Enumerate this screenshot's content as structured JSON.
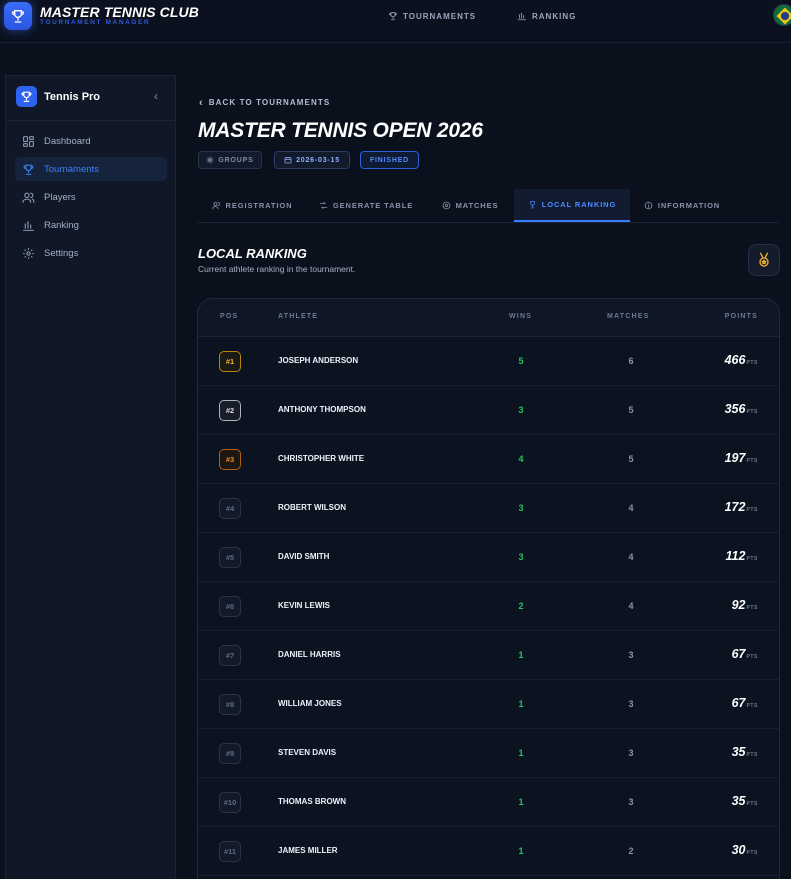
{
  "app": {
    "title": "MASTER TENNIS CLUB",
    "subtitle": "TOURNAMENT MANAGER"
  },
  "top_nav": [
    {
      "label": "TOURNAMENTS",
      "icon": "trophy-icon"
    },
    {
      "label": "RANKING",
      "icon": "bar-chart-icon"
    }
  ],
  "sidebar": {
    "title": "Tennis Pro",
    "items": [
      {
        "label": "Dashboard",
        "icon": "dashboard-icon",
        "active": false
      },
      {
        "label": "Tournaments",
        "icon": "trophy-icon",
        "active": true
      },
      {
        "label": "Players",
        "icon": "users-icon",
        "active": false
      },
      {
        "label": "Ranking",
        "icon": "bar-chart-icon",
        "active": false
      },
      {
        "label": "Settings",
        "icon": "gear-icon",
        "active": false
      }
    ]
  },
  "main": {
    "back_label": "BACK TO TOURNAMENTS",
    "title": "MASTER TENNIS OPEN 2026",
    "chips": {
      "format": "GROUPS",
      "date": "2026-03-15",
      "status": "FINISHED"
    },
    "tabs": [
      {
        "label": "REGISTRATION",
        "icon": "users-icon",
        "active": false
      },
      {
        "label": "GENERATE TABLE",
        "icon": "shuffle-icon",
        "active": false
      },
      {
        "label": "MATCHES",
        "icon": "target-icon",
        "active": false
      },
      {
        "label": "LOCAL RANKING",
        "icon": "trophy-icon",
        "active": true
      },
      {
        "label": "INFORMATION",
        "icon": "info-icon",
        "active": false
      }
    ],
    "section": {
      "title": "LOCAL RANKING",
      "subtitle": "Current athlete ranking in the tournament."
    }
  },
  "ranking": {
    "columns": {
      "pos": "POS",
      "athlete": "ATHLETE",
      "wins": "WINS",
      "matches": "MATCHES",
      "points": "POINTS"
    },
    "points_unit": "PTS",
    "rows": [
      {
        "pos": "#1",
        "athlete": "JOSEPH ANDERSON",
        "wins": "5",
        "matches": "6",
        "points": "466",
        "tier": "gold"
      },
      {
        "pos": "#2",
        "athlete": "ANTHONY THOMPSON",
        "wins": "3",
        "matches": "5",
        "points": "356",
        "tier": "silver"
      },
      {
        "pos": "#3",
        "athlete": "CHRISTOPHER WHITE",
        "wins": "4",
        "matches": "5",
        "points": "197",
        "tier": "bronze"
      },
      {
        "pos": "#4",
        "athlete": "ROBERT WILSON",
        "wins": "3",
        "matches": "4",
        "points": "172",
        "tier": "none"
      },
      {
        "pos": "#5",
        "athlete": "DAVID SMITH",
        "wins": "3",
        "matches": "4",
        "points": "112",
        "tier": "none"
      },
      {
        "pos": "#6",
        "athlete": "KEVIN LEWIS",
        "wins": "2",
        "matches": "4",
        "points": "92",
        "tier": "none"
      },
      {
        "pos": "#7",
        "athlete": "DANIEL HARRIS",
        "wins": "1",
        "matches": "3",
        "points": "67",
        "tier": "none"
      },
      {
        "pos": "#8",
        "athlete": "WILLIAM JONES",
        "wins": "1",
        "matches": "3",
        "points": "67",
        "tier": "none"
      },
      {
        "pos": "#9",
        "athlete": "STEVEN DAVIS",
        "wins": "1",
        "matches": "3",
        "points": "35",
        "tier": "none"
      },
      {
        "pos": "#10",
        "athlete": "THOMAS BROWN",
        "wins": "1",
        "matches": "3",
        "points": "35",
        "tier": "none"
      },
      {
        "pos": "#11",
        "athlete": "JAMES MILLER",
        "wins": "1",
        "matches": "2",
        "points": "30",
        "tier": "none"
      }
    ]
  },
  "colors": {
    "accent": "#3b82f6",
    "wins": "#22c55e",
    "gold": "#f1b52a",
    "silver": "#d7dce6",
    "bronze": "#f08a24",
    "background": "#0a101c"
  }
}
